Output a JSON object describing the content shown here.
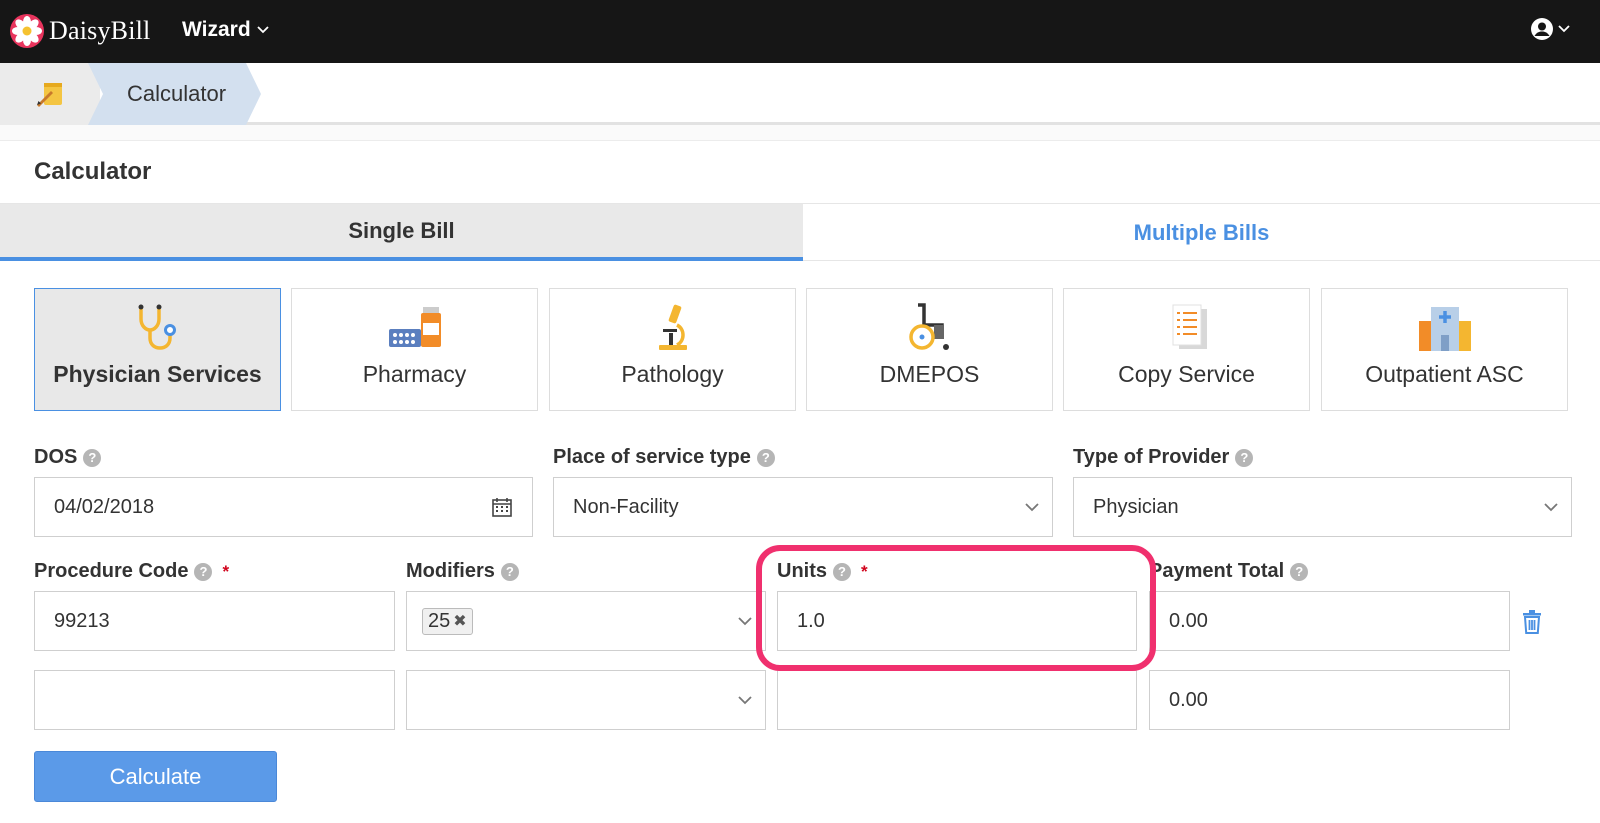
{
  "app": {
    "brand": "DaisyBill",
    "menu_label": "Wizard"
  },
  "breadcrumb": {
    "current": "Calculator"
  },
  "page": {
    "title": "Calculator"
  },
  "tabs": [
    {
      "label": "Single Bill",
      "active": true
    },
    {
      "label": "Multiple Bills",
      "active": false
    }
  ],
  "categories": [
    {
      "label": "Physician Services",
      "icon": "stethoscope-icon",
      "active": true
    },
    {
      "label": "Pharmacy",
      "icon": "pills-icon",
      "active": false
    },
    {
      "label": "Pathology",
      "icon": "microscope-icon",
      "active": false
    },
    {
      "label": "DMEPOS",
      "icon": "wheelchair-icon",
      "active": false
    },
    {
      "label": "Copy Service",
      "icon": "document-copy-icon",
      "active": false
    },
    {
      "label": "Outpatient ASC",
      "icon": "hospital-icon",
      "active": false
    }
  ],
  "form": {
    "dos": {
      "label": "DOS",
      "value": "04/02/2018"
    },
    "place_of_service": {
      "label": "Place of service type",
      "value": "Non-Facility"
    },
    "provider_type": {
      "label": "Type of Provider",
      "value": "Physician"
    },
    "columns": {
      "procedure_code": "Procedure Code",
      "modifiers": "Modifiers",
      "units": "Units",
      "payment_total": "Payment Total"
    },
    "required_marker": "*",
    "rows": [
      {
        "procedure_code": "99213",
        "modifiers": [
          "25"
        ],
        "units": "1.0",
        "payment_total": "0.00"
      },
      {
        "procedure_code": "",
        "modifiers": [],
        "units": "",
        "payment_total": "0.00"
      }
    ],
    "calculate_label": "Calculate"
  },
  "colors": {
    "accent": "#4a90e2",
    "highlight": "#f0306e",
    "button": "#5b9ae8",
    "topbar": "#161616"
  }
}
